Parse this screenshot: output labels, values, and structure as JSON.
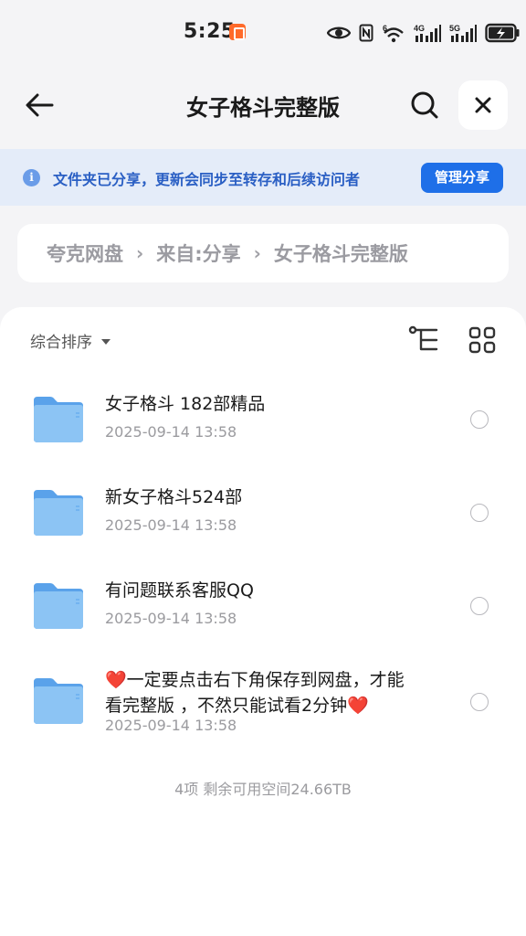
{
  "status_bar": {
    "time": "5:25",
    "icons": [
      "eye-icon",
      "nfc-icon",
      "wifi-6-icon",
      "signal-4g-icon",
      "signal-5g-icon",
      "battery-charging-icon"
    ],
    "network_labels": [
      "6",
      "4G",
      "5G"
    ]
  },
  "header": {
    "title": "女子格斗完整版",
    "back_icon": "arrow-left-icon",
    "search_icon": "search-icon",
    "close_icon": "close-icon"
  },
  "share_banner": {
    "text": "文件夹已分享，更新会同步至转存和后续访问者",
    "button_label": "管理分享",
    "info_glyph": "i"
  },
  "breadcrumb": {
    "items": [
      "夸克网盘",
      "来自:分享",
      "女子格斗完整版"
    ]
  },
  "toolbar": {
    "sort_label": "综合排序"
  },
  "files": [
    {
      "name": "女子格斗 182部精品",
      "date": "2025-09-14 13:58"
    },
    {
      "name": "新女子格斗524部",
      "date": "2025-09-14 13:58"
    },
    {
      "name": "有问题联系客服QQ",
      "date": "2025-09-14 13:58"
    },
    {
      "name_prefix": "❤️",
      "name_text": "一定要点击右下角保存到网盘，才能看完整版 ，不然只能试看2分钟",
      "name_suffix": "❤️",
      "date": "2025-09-14 13:58"
    }
  ],
  "footer": {
    "summary": "4项 剩余可用空间24.66TB"
  },
  "colors": {
    "accent": "#1e6fe8",
    "banner_bg": "#e4ecf9",
    "banner_text": "#2a5fc4",
    "folder": "#7db8f0",
    "page_bg": "#f4f4f6"
  }
}
